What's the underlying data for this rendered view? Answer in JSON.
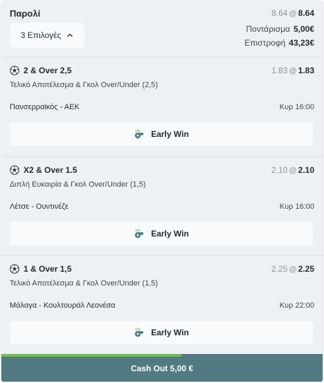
{
  "header": {
    "title": "Παρολί",
    "selections_label": "3 Επιλογές",
    "odds_old": "8.64",
    "odds_at": "@",
    "odds_new": "8.64",
    "stake_label": "Ποντάρισμα",
    "stake_value": "5,00€",
    "return_label": "Επιστροφή",
    "return_value": "43,23€"
  },
  "legs": [
    {
      "selection": "2 & Over 2,5",
      "odds_old": "1.83",
      "odds_new": "1.83",
      "market": "Τελικό Αποτέλεσμα & Γκολ Over/Under (2,5)",
      "event": "Πανσερραϊκός - ΑΕΚ",
      "time": "Κυρ 16:00",
      "early_win_label": "Early Win"
    },
    {
      "selection": "X2 & Over 1.5",
      "odds_old": "2.10",
      "odds_new": "2.10",
      "market": "Διπλή Ευκαιρία & Γκολ Over/Under (1,5)",
      "event": "Λέτσε - Ουντινέζε",
      "time": "Κυρ 16:00",
      "early_win_label": "Early Win"
    },
    {
      "selection": "1 & Over 1,5",
      "odds_old": "2.25",
      "odds_new": "2.25",
      "market": "Τελικό Αποτέλεσμα & Γκολ Over/Under (1,5)",
      "event": "Μάλαγα - Κουλτουράλ Λεονέσα",
      "time": "Κυρ 22:00",
      "early_win_label": "Early Win"
    }
  ],
  "cashout": {
    "label": "Cash Out 5,00 €",
    "progress_fraction": 0.56
  },
  "colors": {
    "cashout_bg": "#527a82",
    "progress": "#6fbf4a",
    "early_win_icon": "#4a7f87"
  },
  "icons": {
    "selections_toggle": "chevron-up-icon",
    "sport": "soccer-ball-icon",
    "early_win": "whistle-icon"
  }
}
